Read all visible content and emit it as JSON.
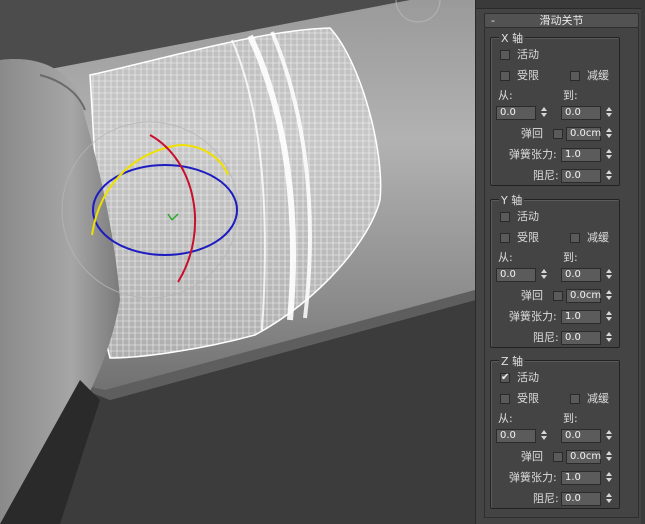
{
  "rollout": {
    "collapse_symbol": "-",
    "title": "滑动关节"
  },
  "groups": [
    {
      "label": "X 轴",
      "active": {
        "label": "活动",
        "checked": false
      },
      "limited": {
        "label": "受限",
        "checked": false
      },
      "ease": {
        "label": "减缓",
        "checked": false
      },
      "from_label": "从:",
      "to_label": "到:",
      "from_value": "0.0",
      "to_value": "0.0",
      "bounce": {
        "label": "弹回",
        "checked": false,
        "value": "0.0cm"
      },
      "spring_tension": {
        "label": "弹簧张力:",
        "value": "1.0"
      },
      "damping": {
        "label": "阻尼:",
        "value": "0.0"
      }
    },
    {
      "label": "Y 轴",
      "active": {
        "label": "活动",
        "checked": false
      },
      "limited": {
        "label": "受限",
        "checked": false
      },
      "ease": {
        "label": "减缓",
        "checked": false
      },
      "from_label": "从:",
      "to_label": "到:",
      "from_value": "0.0",
      "to_value": "0.0",
      "bounce": {
        "label": "弹回",
        "checked": false,
        "value": "0.0cm"
      },
      "spring_tension": {
        "label": "弹簧张力:",
        "value": "1.0"
      },
      "damping": {
        "label": "阻尼:",
        "value": "0.0"
      }
    },
    {
      "label": "Z 轴",
      "active": {
        "label": "活动",
        "checked": true
      },
      "limited": {
        "label": "受限",
        "checked": false
      },
      "ease": {
        "label": "减缓",
        "checked": false
      },
      "from_label": "从:",
      "to_label": "到:",
      "from_value": "0.0",
      "to_value": "0.0",
      "bounce": {
        "label": "弹回",
        "checked": false,
        "value": "0.0cm"
      },
      "spring_tension": {
        "label": "弹簧张力:",
        "value": "1.0"
      },
      "damping": {
        "label": "阻尼:",
        "value": "0.0"
      }
    }
  ],
  "colors": {
    "gizmo_x": "#c8102e",
    "gizmo_y": "#f0e000",
    "gizmo_z": "#1c1cc0",
    "wireframe": "#ffffff"
  }
}
